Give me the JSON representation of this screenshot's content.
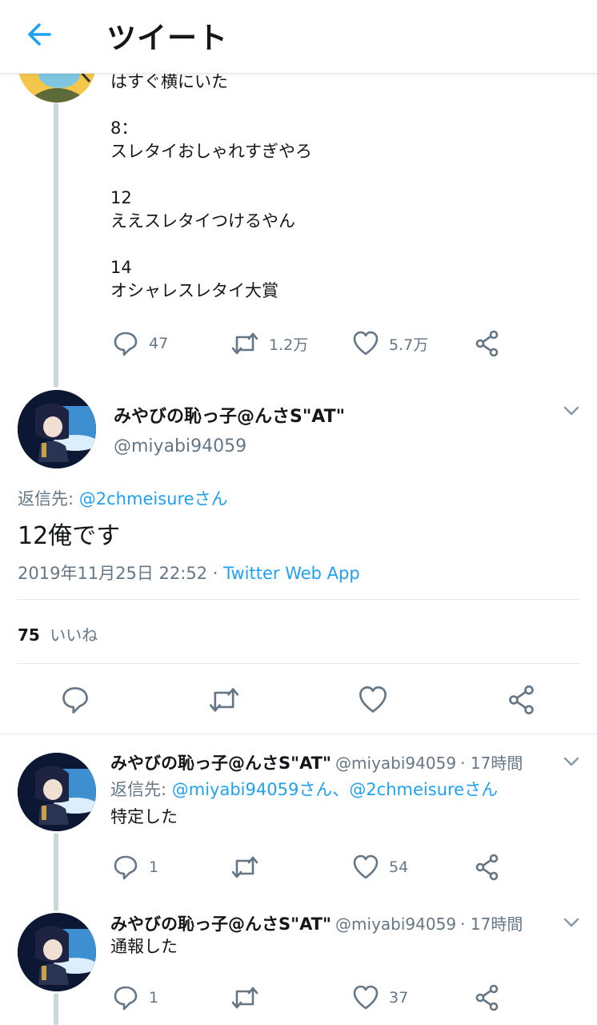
{
  "header": {
    "title": "ツイート"
  },
  "prev_tweet": {
    "lines": [
      "はすぐ横にいた",
      "",
      "8：",
      "スレタイおしゃれすぎやろ",
      "",
      "12",
      "ええスレタイつけるやん",
      "",
      "14",
      "オシャレスレタイ大賞"
    ],
    "stats": {
      "replies": "47",
      "retweets": "1.2万",
      "likes": "5.7万"
    }
  },
  "main_tweet": {
    "name": "みやびの恥っ子@んさS\"AT\"",
    "handle": "@miyabi94059",
    "reply_prefix": "返信先:",
    "reply_to": "@2chmeisureさん",
    "text": "12俺です",
    "timestamp": "2019年11月25日 22:52",
    "separator": "·",
    "source": "Twitter Web App",
    "likes_count": "75",
    "likes_label": "いいね"
  },
  "replies": [
    {
      "name": "みやびの恥っ子@んさS\"AT\"",
      "handle": "@miyabi94059",
      "time": "· 17時間",
      "reply_prefix": "返信先:",
      "reply_to": "@miyabi94059さん、@2chmeisureさん",
      "text": "特定した",
      "replies": "1",
      "likes": "54"
    },
    {
      "name": "みやびの恥っ子@んさS\"AT\"",
      "handle": "@miyabi94059",
      "time": "· 17時間",
      "text": "通報した",
      "replies": "1",
      "likes": "37"
    }
  ],
  "colors": {
    "accent": "#1da1f2",
    "muted": "#657786",
    "line": "#ccd6dd"
  }
}
